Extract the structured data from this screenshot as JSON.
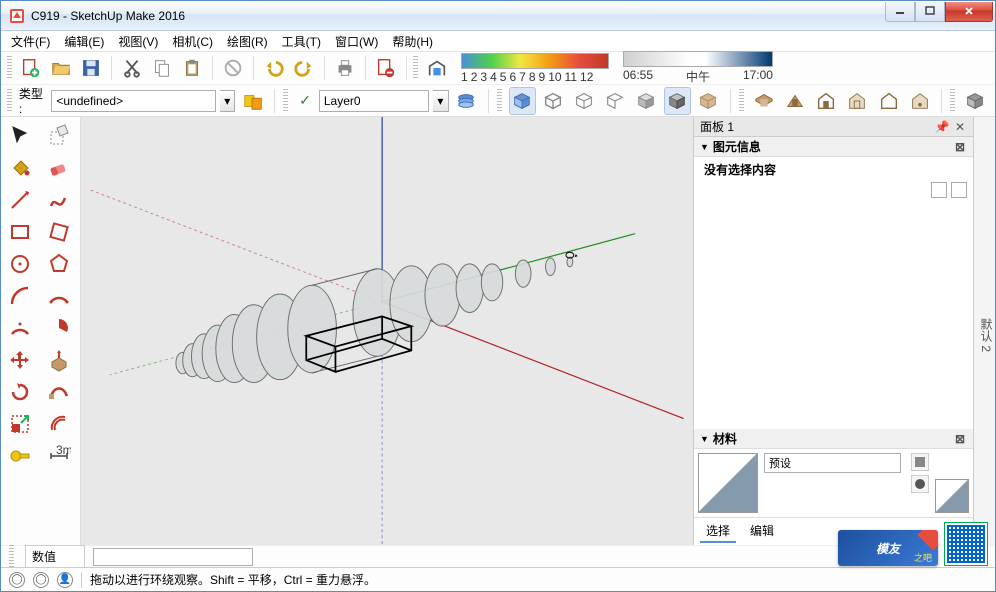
{
  "window": {
    "title": "C919 - SketchUp Make 2016"
  },
  "menus": [
    "文件(F)",
    "编辑(E)",
    "视图(V)",
    "相机(C)",
    "绘图(R)",
    "工具(T)",
    "窗口(W)",
    "帮助(H)"
  ],
  "type_panel": {
    "label": "类型 :",
    "value": "<undefined>"
  },
  "layer_panel": {
    "tick": "✓",
    "value": "Layer0"
  },
  "spectrum_labels": [
    "1",
    "2",
    "3",
    "4",
    "5",
    "6",
    "7",
    "8",
    "9",
    "10",
    "11",
    "12"
  ],
  "shadow": {
    "left": "06:55",
    "mid": "中午",
    "right": "17:00"
  },
  "tray": {
    "title": "面板 1",
    "entity_info": {
      "header": "图元信息",
      "message": "没有选择内容"
    },
    "materials": {
      "header": "材料",
      "preset_label": "预设",
      "tab_select": "选择",
      "tab_edit": "编辑"
    }
  },
  "sidebar_tab": "默认 2",
  "vcb": {
    "label": "数值",
    "value": ""
  },
  "status_hint": "拖动以进行环绕观察。Shift = 平移，Ctrl = 重力悬浮。",
  "watermark": {
    "text": "模友",
    "sub": "之吧"
  }
}
